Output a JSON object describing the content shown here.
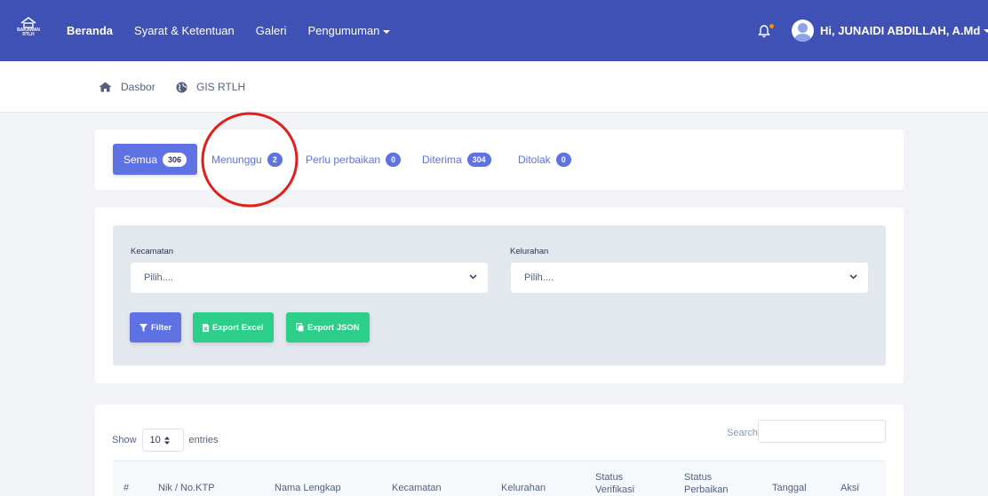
{
  "brand": {
    "text": "BAKAWAN RTLH",
    "icon": "house-logo-icon"
  },
  "nav": {
    "items": [
      {
        "label": "Beranda",
        "active": true
      },
      {
        "label": "Syarat & Ketentuan"
      },
      {
        "label": "Galeri"
      },
      {
        "label": "Pengumuman"
      }
    ],
    "user_name": "Hi, JUNAIDI ABDILLAH, A.Md",
    "colors": {
      "navbar": "#3f51b5",
      "notification_dot": "#fb8c00"
    }
  },
  "breadcrumb": [
    {
      "label": "Dasbor",
      "icon": "home-icon"
    },
    {
      "label": "GIS RTLH",
      "icon": "globe-icon"
    }
  ],
  "tabs": [
    {
      "label": "Semua",
      "count": "306",
      "active": true
    },
    {
      "label": "Menunggu",
      "count": "2"
    },
    {
      "label": "Perlu perbaikan",
      "count": "0"
    },
    {
      "label": "Diterima",
      "count": "304"
    },
    {
      "label": "Ditolak",
      "count": "0"
    }
  ],
  "filter": {
    "kecamatan_label": "Kecamatan",
    "kecamatan_value": "Pilih....",
    "kelurahan_label": "Kelurahan",
    "kelurahan_value": "Pilih....",
    "filter_btn": "Filter",
    "excel_btn": "Export Excel",
    "json_btn": "Export JSON",
    "colors": {
      "primary": "#5e72e4",
      "success": "#2dce89"
    }
  },
  "table": {
    "show_label": "Show",
    "entries_value": "10",
    "entries_label": "entries",
    "search_label": "Search:",
    "columns": [
      "#",
      "Nik / No.KTP",
      "Nama Lengkap",
      "Kecamatan",
      "Kelurahan",
      "Status Verifikasi",
      "Status Perbaikan",
      "Tanggal",
      "Aksi"
    ]
  }
}
